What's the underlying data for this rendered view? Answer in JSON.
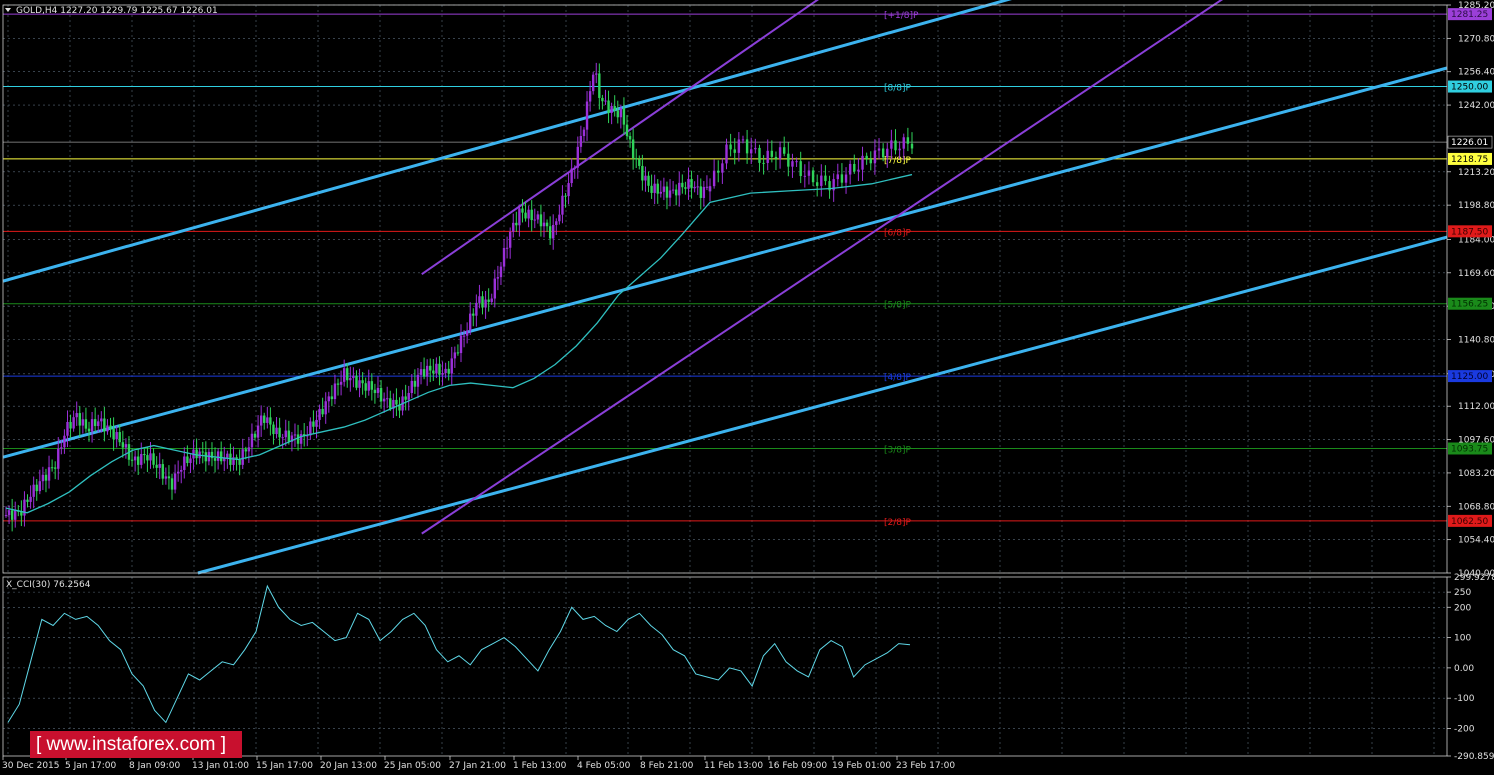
{
  "header": {
    "symbol_info": "GOLD,H4  1227.20 1229.79 1225.67 1226.01",
    "indicator_info": "X_CCI(30) 76.2564"
  },
  "watermark": "[ www.instaforex.com ]",
  "colors": {
    "background": "#000000",
    "grid": "#5a6a7a",
    "bull_candle": "#9b30d9",
    "bear_candle": "#2fd35a",
    "moving_average": "#2fbfbf",
    "cci": "#5fd8e8",
    "channel_blue": "#3cb3ef",
    "channel_purple": "#8a3fd8"
  },
  "chart_data": [
    {
      "type": "candlestick",
      "title": "GOLD,H4",
      "ylim": [
        1040.0,
        1285.2
      ],
      "y_ticks": [
        "1285.20",
        "1270.80",
        "1256.40",
        "1242.00",
        "1226.01",
        "1213.20",
        "1198.80",
        "1184.00",
        "1169.60",
        "1155.20",
        "1140.80",
        "1126.00",
        "1112.00",
        "1097.60",
        "1083.20",
        "1068.80",
        "1054.40",
        "1040.00"
      ],
      "x_ticks": [
        "30 Dec 2015",
        "5 Jan 17:00",
        "8 Jan 09:00",
        "13 Jan 01:00",
        "15 Jan 17:00",
        "20 Jan 13:00",
        "25 Jan 05:00",
        "27 Jan 21:00",
        "1 Feb 13:00",
        "4 Feb 05:00",
        "8 Feb 21:00",
        "11 Feb 13:00",
        "16 Feb 09:00",
        "19 Feb 01:00",
        "23 Feb 17:00"
      ],
      "price_path": [
        [
          0,
          1065
        ],
        [
          0.02,
          1066
        ],
        [
          0.035,
          1074
        ],
        [
          0.05,
          1080
        ],
        [
          0.07,
          1087
        ],
        [
          0.085,
          1102
        ],
        [
          0.1,
          1108
        ],
        [
          0.115,
          1102
        ],
        [
          0.13,
          1106
        ],
        [
          0.15,
          1101
        ],
        [
          0.165,
          1096
        ],
        [
          0.18,
          1088
        ],
        [
          0.2,
          1091
        ],
        [
          0.215,
          1086
        ],
        [
          0.235,
          1078
        ],
        [
          0.25,
          1087
        ],
        [
          0.27,
          1092
        ],
        [
          0.29,
          1090
        ],
        [
          0.31,
          1090
        ],
        [
          0.33,
          1088
        ],
        [
          0.35,
          1098
        ],
        [
          0.365,
          1108
        ],
        [
          0.385,
          1100
        ],
        [
          0.4,
          1099
        ],
        [
          0.42,
          1098
        ],
        [
          0.44,
          1106
        ],
        [
          0.46,
          1116
        ],
        [
          0.48,
          1126
        ],
        [
          0.5,
          1122
        ],
        [
          0.52,
          1120
        ],
        [
          0.54,
          1114
        ],
        [
          0.56,
          1112
        ],
        [
          0.575,
          1120
        ],
        [
          0.59,
          1127
        ],
        [
          0.61,
          1128
        ],
        [
          0.625,
          1126
        ],
        [
          0.64,
          1136
        ],
        [
          0.655,
          1146
        ],
        [
          0.67,
          1158
        ],
        [
          0.685,
          1156
        ],
        [
          0.7,
          1170
        ],
        [
          0.715,
          1186
        ],
        [
          0.73,
          1196
        ],
        [
          0.745,
          1194
        ],
        [
          0.76,
          1192
        ],
        [
          0.775,
          1186
        ],
        [
          0.79,
          1200
        ],
        [
          0.805,
          1214
        ],
        [
          0.82,
          1232
        ],
        [
          0.835,
          1258
        ],
        [
          0.845,
          1244
        ],
        [
          0.86,
          1240
        ],
        [
          0.875,
          1238
        ],
        [
          0.885,
          1226
        ],
        [
          0.9,
          1214
        ],
        [
          0.915,
          1206
        ],
        [
          0.93,
          1205
        ],
        [
          0.945,
          1204
        ],
        [
          0.96,
          1207
        ],
        [
          0.975,
          1208
        ],
        [
          0.985,
          1204
        ],
        [
          1.0,
          1207
        ]
      ],
      "price_path_2": [
        [
          0,
          1207
        ],
        [
          0.08,
          1222
        ],
        [
          0.16,
          1226
        ],
        [
          0.26,
          1218
        ],
        [
          0.34,
          1222
        ],
        [
          0.42,
          1216
        ],
        [
          0.5,
          1210
        ],
        [
          0.6,
          1208
        ],
        [
          0.7,
          1214
        ],
        [
          0.8,
          1220
        ],
        [
          0.9,
          1224
        ],
        [
          1.0,
          1226
        ]
      ],
      "moving_average": [
        [
          0,
          1068
        ],
        [
          0.03,
          1066
        ],
        [
          0.06,
          1070
        ],
        [
          0.09,
          1075
        ],
        [
          0.12,
          1082
        ],
        [
          0.15,
          1088
        ],
        [
          0.18,
          1093
        ],
        [
          0.21,
          1095
        ],
        [
          0.24,
          1093
        ],
        [
          0.27,
          1091
        ],
        [
          0.3,
          1090
        ],
        [
          0.33,
          1089
        ],
        [
          0.36,
          1091
        ],
        [
          0.39,
          1095
        ],
        [
          0.42,
          1099
        ],
        [
          0.45,
          1101
        ],
        [
          0.48,
          1103
        ],
        [
          0.51,
          1106
        ],
        [
          0.54,
          1110
        ],
        [
          0.57,
          1114
        ],
        [
          0.6,
          1118
        ],
        [
          0.63,
          1121
        ],
        [
          0.66,
          1122
        ],
        [
          0.69,
          1121
        ],
        [
          0.72,
          1120
        ],
        [
          0.75,
          1124
        ],
        [
          0.78,
          1130
        ],
        [
          0.81,
          1138
        ],
        [
          0.84,
          1148
        ],
        [
          0.87,
          1160
        ],
        [
          0.9,
          1168
        ],
        [
          0.93,
          1176
        ],
        [
          0.96,
          1186
        ],
        [
          1.0,
          1200
        ]
      ],
      "moving_average_2": [
        [
          0,
          1200
        ],
        [
          0.2,
          1204
        ],
        [
          0.4,
          1205
        ],
        [
          0.6,
          1206
        ],
        [
          0.8,
          1208
        ],
        [
          1.0,
          1212
        ]
      ],
      "murrey_levels": [
        {
          "label": "[+1/8]P",
          "value": 1281.25,
          "tag": "1281.25",
          "color": "#9b3fd8",
          "tag_text": "#2a0d45"
        },
        {
          "label": "[8/8]P",
          "value": 1250.0,
          "tag": "1250.00",
          "color": "#30cfe0",
          "tag_text": "#000000"
        },
        {
          "label": "[7/8]P",
          "value": 1218.75,
          "tag": "1218.75",
          "color": "#ffff40",
          "tag_text": "#000000"
        },
        {
          "label": "[6/8]P",
          "value": 1187.5,
          "tag": "1187.50",
          "color": "#e01a1a",
          "tag_text": "#3a0000"
        },
        {
          "label": "[5/8]P",
          "value": 1156.25,
          "tag": "1156.25",
          "color": "#1a8a1a",
          "tag_text": "#003000"
        },
        {
          "label": "[4/8]P",
          "value": 1125.0,
          "tag": "1125.00",
          "color": "#1a3ae0",
          "tag_text": "#000030"
        },
        {
          "label": "[3/8]P",
          "value": 1093.75,
          "tag": "1093.75",
          "color": "#1a8a1a",
          "tag_text": "#003000"
        },
        {
          "label": "[2/8]P",
          "value": 1062.5,
          "tag": "1062.50",
          "color": "#e01a1a",
          "tag_text": "#3a0000"
        }
      ],
      "current_price": {
        "value": 1226.01,
        "tag": "1226.01"
      }
    },
    {
      "type": "line",
      "title": "X_CCI(30) 76.2564",
      "ylim": [
        -290.8596,
        299.9278
      ],
      "y_ticks": [
        "299.9278",
        "250",
        "200",
        "100",
        "0.00",
        "-100",
        "-200",
        "-290.8596"
      ],
      "values": [
        -180,
        -120,
        20,
        160,
        140,
        180,
        160,
        170,
        140,
        90,
        60,
        -20,
        -60,
        -140,
        -180,
        -100,
        -20,
        -40,
        -10,
        20,
        10,
        60,
        120,
        270,
        200,
        160,
        140,
        150,
        120,
        90,
        100,
        180,
        160,
        90,
        120,
        160,
        180,
        140,
        60,
        20,
        40,
        10,
        60,
        80,
        100,
        70,
        30,
        -10,
        60,
        120,
        200,
        160,
        170,
        140,
        120,
        160,
        180,
        140,
        110,
        60,
        40,
        -20,
        -30,
        -40,
        0,
        -10,
        -60,
        40,
        80,
        20,
        -10,
        -30,
        60,
        90,
        70,
        -30,
        10,
        30,
        50,
        80,
        76.26
      ],
      "values_extra_note": ""
    }
  ]
}
